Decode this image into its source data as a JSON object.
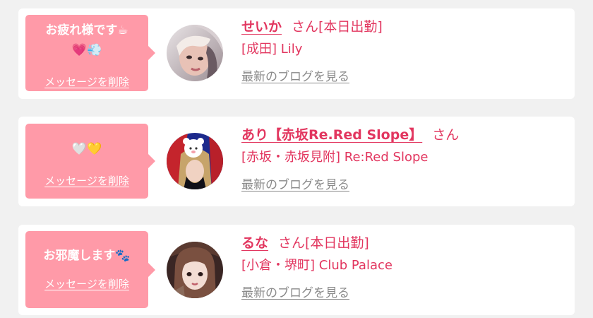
{
  "messages": [
    {
      "message": "お疲れ様です☕\n💗💨",
      "delete_label": "メッセージを削除",
      "name": "せいか",
      "name_suffix": "さん[本日出勤]",
      "shop": "[成田] Lily",
      "blog_label": "最新のブログを見る"
    },
    {
      "message": "🤍💛",
      "delete_label": "メッセージを削除",
      "name": "あり【赤坂Re.Red Slope】",
      "name_suffix": "さん",
      "shop": "[赤坂・赤坂見附] Re:Red Slope",
      "blog_label": "最新のブログを見る"
    },
    {
      "message": "お邪魔します🐾",
      "delete_label": "メッセージを削除",
      "name": "るな",
      "name_suffix": "さん[本日出勤]",
      "shop": "[小倉・堺町] Club Palace",
      "blog_label": "最新のブログを見る"
    }
  ],
  "colors": {
    "page_background": "#f1f1f1",
    "card_background": "#ffffff",
    "bubble": "#ff9aa8",
    "accent": "#e2365f",
    "link_gray": "#8a8a8a"
  }
}
